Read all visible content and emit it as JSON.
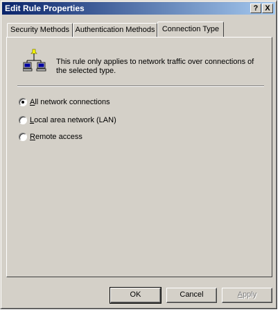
{
  "window": {
    "title": "Edit Rule Properties",
    "help_button": "?",
    "close_button": "X"
  },
  "tabs": [
    {
      "label": "Security Methods"
    },
    {
      "label": "Authentication Methods"
    },
    {
      "label": "Connection Type"
    }
  ],
  "connection": {
    "icon": "network-computers-icon",
    "description": "This rule only applies to network traffic over connections of the selected type.",
    "options": [
      {
        "label_pre": "",
        "label_ul": "A",
        "label_post": "ll network connections",
        "selected": true
      },
      {
        "label_pre": "",
        "label_ul": "L",
        "label_post": "ocal area network (LAN)",
        "selected": false
      },
      {
        "label_pre": "",
        "label_ul": "R",
        "label_post": "emote access",
        "selected": false
      }
    ]
  },
  "buttons": {
    "ok": "OK",
    "cancel": "Cancel",
    "apply_pre": "",
    "apply_ul": "A",
    "apply_post": "pply"
  },
  "colors": {
    "titlebar_start": "#0a246a",
    "titlebar_end": "#a6caf0",
    "face": "#d4d0c8"
  }
}
